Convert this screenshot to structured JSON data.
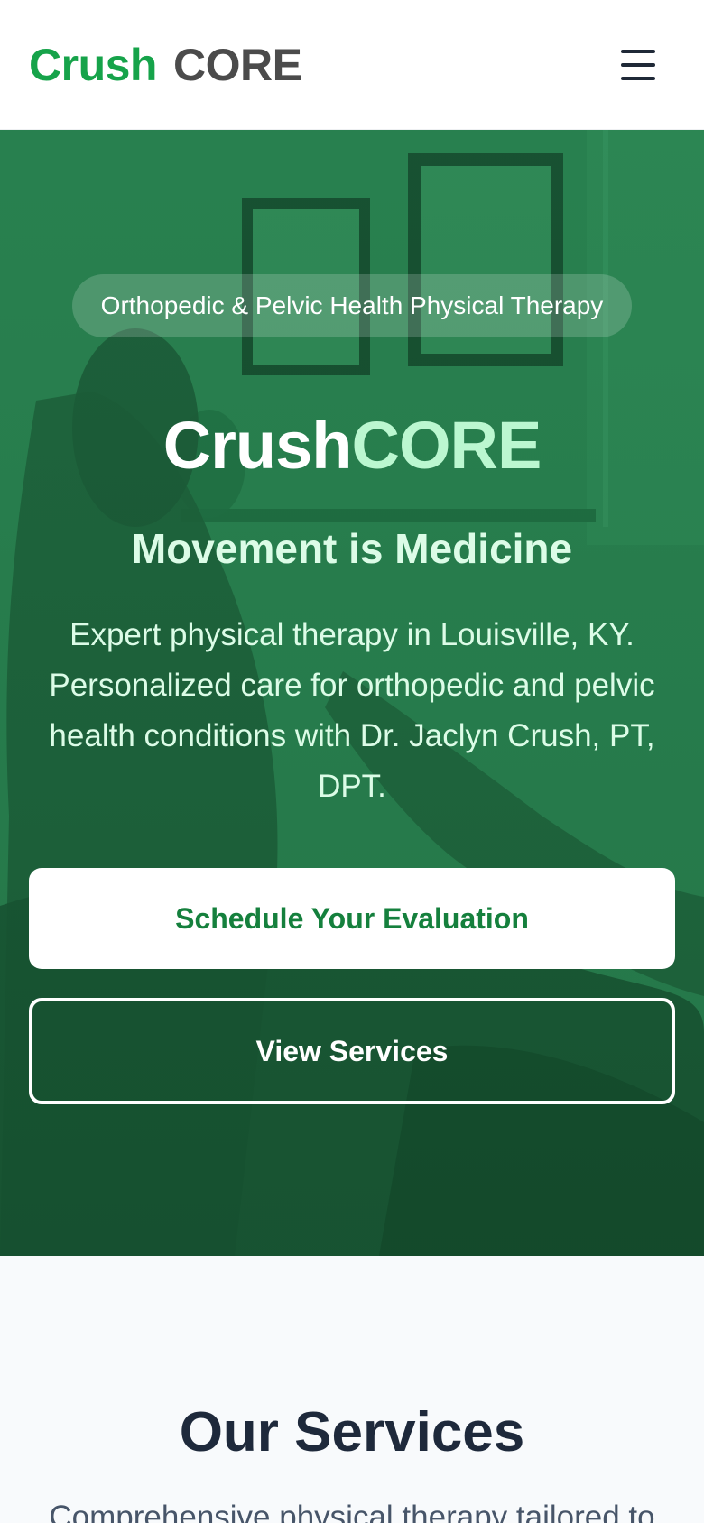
{
  "header": {
    "logo_primary": "Crush",
    "logo_secondary": "CORE",
    "menu_icon": "hamburger-menu-icon"
  },
  "hero": {
    "badge": "Orthopedic & Pelvic Health Physical Therapy",
    "title_part1": "Crush",
    "title_part2": "CORE",
    "tagline": "Movement is Medicine",
    "description": "Expert physical therapy in Louisville, KY. Personalized care for orthopedic and pelvic health conditions with Dr. Jaclyn Crush, PT, DPT.",
    "cta_primary": "Schedule Your Evaluation",
    "cta_secondary": "View Services"
  },
  "services": {
    "title": "Our Services",
    "subtitle": "Comprehensive physical therapy tailored to"
  },
  "colors": {
    "brand_green": "#16a34a",
    "hero_green": "#287a4d",
    "accent_light_green": "#bbf7d0",
    "dark_text": "#1e293b"
  }
}
